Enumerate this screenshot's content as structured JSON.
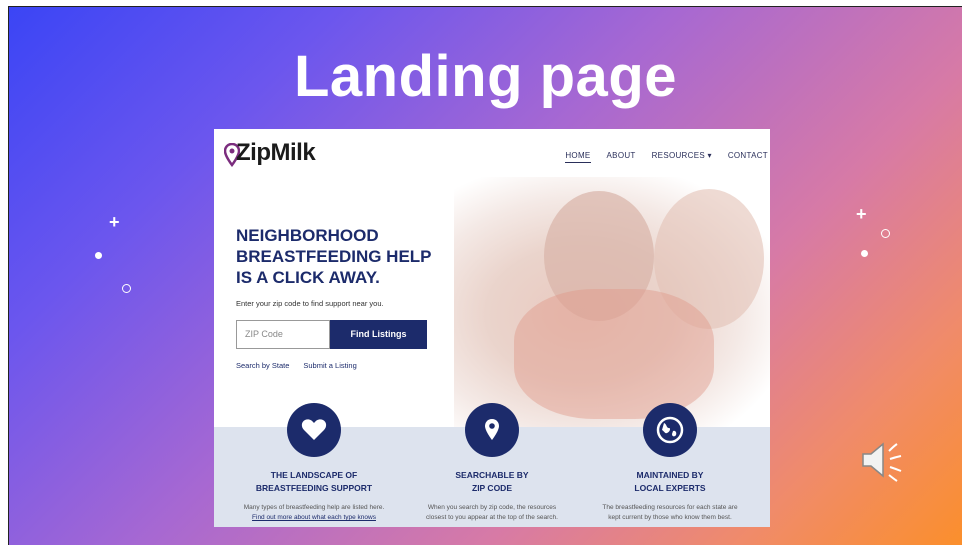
{
  "slide": {
    "title": "Landing page",
    "speaker_icon": "speaker-icon"
  },
  "site": {
    "logo_text": "ZipMilk",
    "logo_icon": "map-pin-icon",
    "nav": {
      "home": "HOME",
      "about": "ABOUT",
      "resources": "RESOURCES ▾",
      "contact": "CONTACT"
    },
    "hero": {
      "line1": "NEIGHBORHOOD",
      "line2": "BREASTFEEDING HELP",
      "line3": "IS A CLICK AWAY.",
      "subtext": "Enter your zip code to find support near you.",
      "zip_placeholder": "ZIP Code",
      "find_button": "Find Listings",
      "link_state": "Search by State",
      "link_submit": "Submit a Listing"
    },
    "features": [
      {
        "icon": "heart-icon",
        "title1": "THE LANDSCAPE OF",
        "title2": "BREASTFEEDING SUPPORT",
        "desc1": "Many types of breastfeeding help are listed here.",
        "desc2": "Find out more about what each type knows"
      },
      {
        "icon": "location-pin-icon",
        "title1": "SEARCHABLE BY",
        "title2": "ZIP CODE",
        "desc1": "When you search by zip code, the resources",
        "desc2": "closest to you appear at the top of the search."
      },
      {
        "icon": "globe-icon",
        "title1": "MAINTAINED BY",
        "title2": "LOCAL EXPERTS",
        "desc1": "The breastfeeding resources for each state are",
        "desc2": "kept current by those who know them best."
      }
    ]
  },
  "colors": {
    "brand_navy": "#1c2b6b",
    "logo_purple": "#7b2d7e",
    "feature_band": "#dde3ee"
  }
}
